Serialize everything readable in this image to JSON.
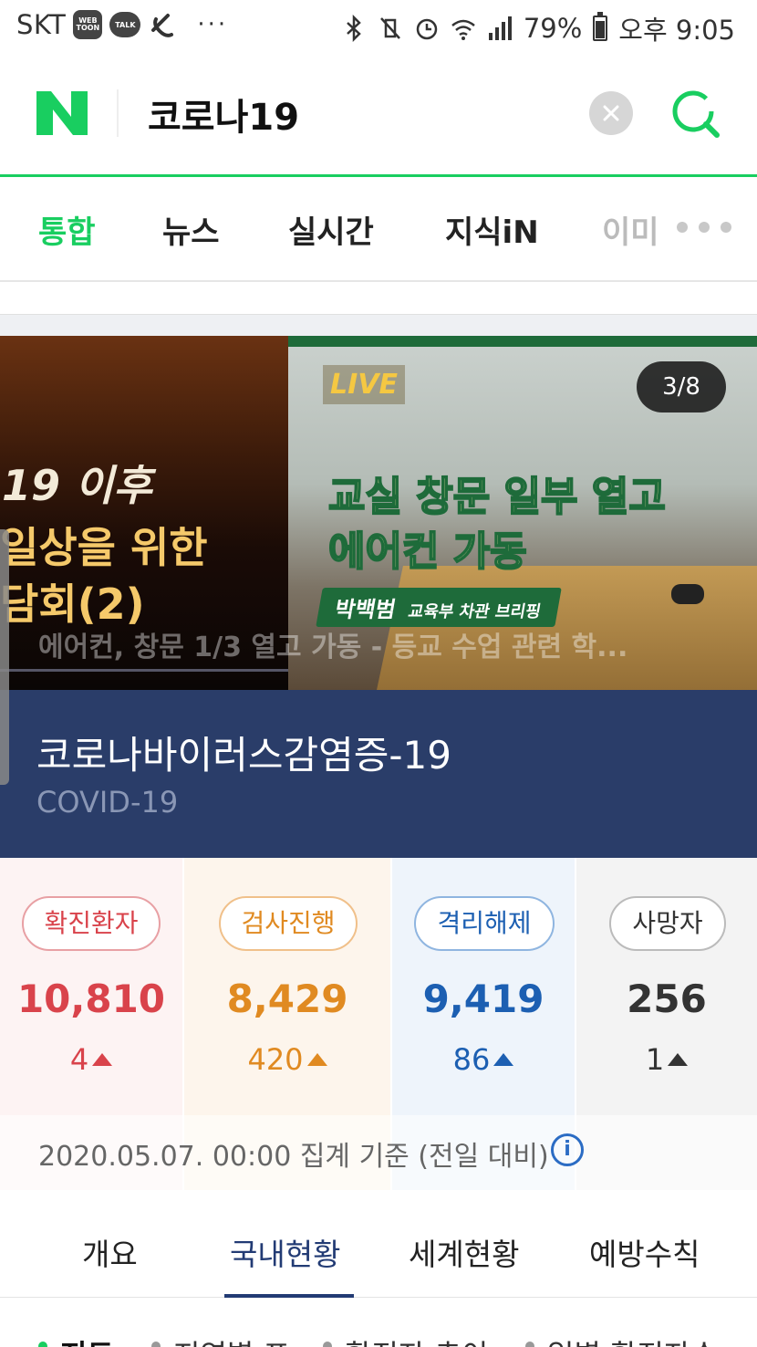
{
  "status_bar": {
    "carrier": "SKT",
    "apps": [
      "WEB TOON",
      "TALK"
    ],
    "overflow": "···",
    "battery": "79%",
    "time": "오후 9:05",
    "icons": [
      "bluetooth-icon",
      "vibrate-mute-icon",
      "alarm-icon",
      "wifi-icon",
      "signal-icon",
      "battery-icon"
    ]
  },
  "search": {
    "logo": "N",
    "query": "코로나19",
    "brand_color": "#19ce60"
  },
  "tabs": [
    {
      "label": "통합",
      "active": true
    },
    {
      "label": "뉴스"
    },
    {
      "label": "실시간"
    },
    {
      "label": "지식iN"
    },
    {
      "label": "이미"
    }
  ],
  "carousel": {
    "left": {
      "line1": "19 이후",
      "line2": "일상을 위한",
      "line3": "담회(2)"
    },
    "right": {
      "live": "LIVE",
      "counter": "3/8",
      "headline1": "교실 창문 일부 열고",
      "headline2": "에어컨 가동",
      "chyron_name": "박백범",
      "chyron_role": "교육부 차관 브리핑",
      "caption": "에어컨, 창문 1/3 열고 가동 - 등교 수업 관련 학..."
    }
  },
  "title": {
    "main": "코로나바이러스감염증-19",
    "sub": "COVID-19"
  },
  "stats": [
    {
      "label": "확진환자",
      "value": "10,810",
      "delta": "4",
      "color": "#d9434b",
      "bg": "#fdf3f3"
    },
    {
      "label": "검사진행",
      "value": "8,429",
      "delta": "420",
      "color": "#e08a21",
      "bg": "#fdf5ec"
    },
    {
      "label": "격리해제",
      "value": "9,419",
      "delta": "86",
      "color": "#1c5fb2",
      "bg": "#eef4fb"
    },
    {
      "label": "사망자",
      "value": "256",
      "delta": "1",
      "color": "#333333",
      "bg": "#f3f3f3"
    }
  ],
  "stamp": {
    "text": "2020.05.07. 00:00 집계 기준 (전일 대비)",
    "info_icon": "i"
  },
  "subtabs": [
    {
      "label": "개요"
    },
    {
      "label": "국내현황",
      "active": true
    },
    {
      "label": "세계현황"
    },
    {
      "label": "예방수칙"
    }
  ],
  "peek": [
    "지도",
    "지역별 표",
    "확진자 추이",
    "일별 확진자수"
  ]
}
